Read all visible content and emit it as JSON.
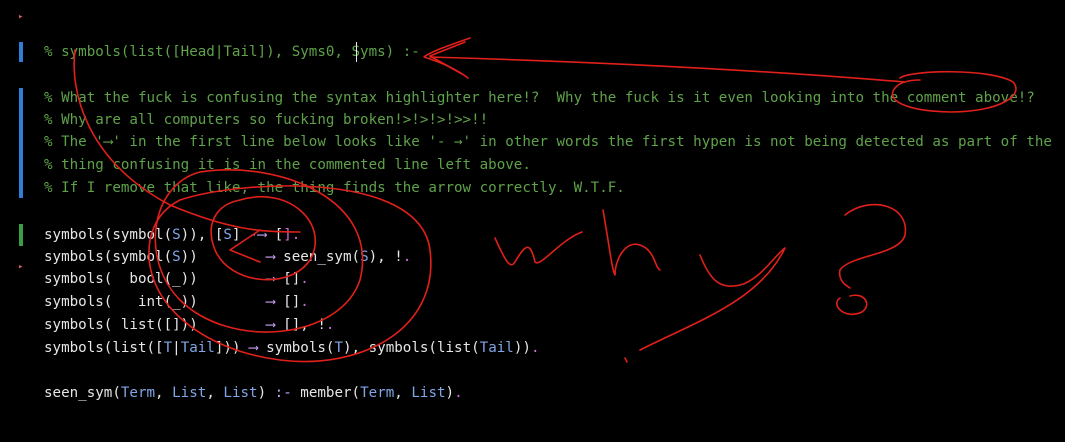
{
  "editor": {
    "header_line": "% symbols(list([Head|Tail]), Syms0, Syms) :-",
    "comment_lines": [
      "% What the fuck is confusing the syntax highlighter here!?  Why the fuck is it even looking into the comment above!?",
      "% Why are all computers so fucking broken!>!>!>!>>!!",
      "% The '⟶' in the first line below looks like '- →' in other words the first hypen is not being detected as part of the",
      "% thing confusing it is in the commented line left above.",
      "% If I remove that like, the thing finds the arrow correctly. W.T.F."
    ],
    "code": {
      "l1": {
        "a": "symbols(symbol(",
        "b": "S",
        "c": ")), [",
        "d": "S",
        "e": "] ",
        "f": "-⟶",
        "g": " [",
        "h": "].",
        "i": ""
      },
      "l2": {
        "a": "symbols(symbol(",
        "b": "S",
        "c": "))        ",
        "f": "⟶",
        "g": " seen_sym(",
        "v": "S",
        "w": "), !",
        "h": "."
      },
      "l3": {
        "a": "symbols(  bool(_))        ",
        "f": "⟶",
        "g": " []",
        "h": "."
      },
      "l4": {
        "a": "symbols(   int(_))        ",
        "f": "⟶",
        "g": " []",
        "h": "."
      },
      "l5": {
        "a": "symbols( list([]))        ",
        "f": "⟶",
        "g": " [], !",
        "h": "."
      },
      "l6": {
        "a": "symbols(list([",
        "b": "T",
        "c": "|",
        "d": "Tail",
        "e": "])) ",
        "f": "⟶",
        "g": " symbols(",
        "v": "T",
        "w": "), symbols(list(",
        "x": "Tail",
        "y": "))",
        "h": "."
      },
      "l7": {
        "a": "seen_sym(",
        "b": "Term",
        "c": ", ",
        "d": "List",
        "e": ", ",
        "v": "List",
        "w": ") ",
        "f": ":-",
        "g": " member(",
        "x": "Term",
        "y": ", ",
        "z": "List",
        "zz": ")",
        "h": "."
      }
    },
    "scribble_text": "why?",
    "colors": {
      "comment": "#5fa24a",
      "variable": "#7fa6e6",
      "operator": "#c9a0f7",
      "annotation": "#e0201a",
      "gutter_blue": "#2d7fd3",
      "gutter_green": "#3a9e44"
    }
  }
}
